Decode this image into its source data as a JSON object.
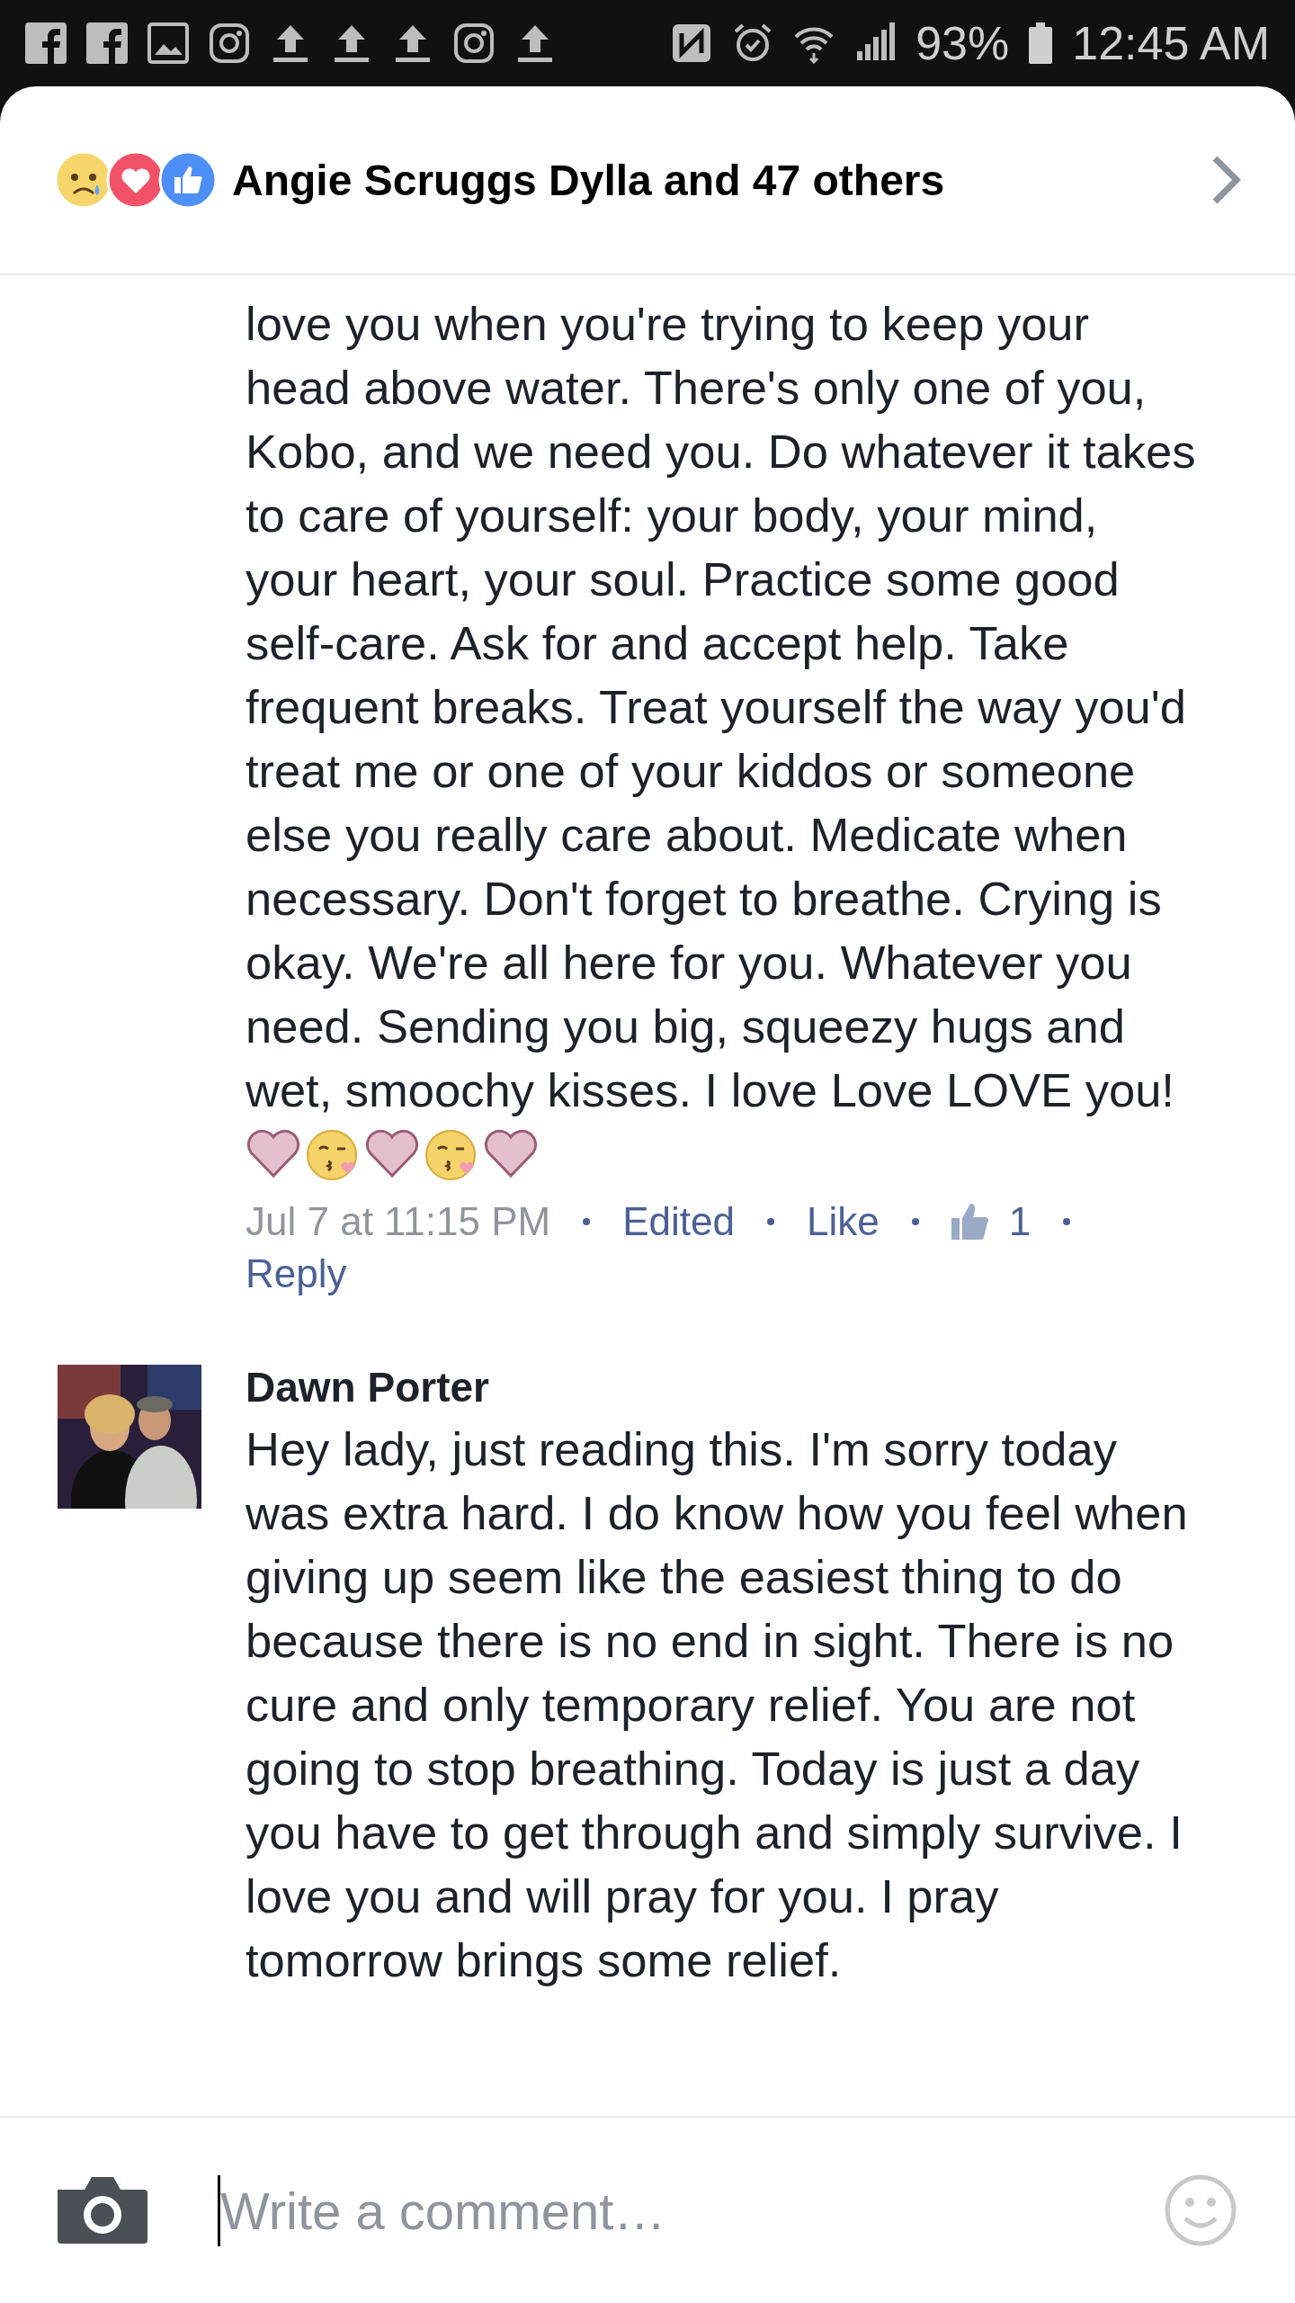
{
  "status_bar": {
    "notifications": [
      {
        "kind": "facebook"
      },
      {
        "kind": "facebook"
      },
      {
        "kind": "gallery"
      },
      {
        "kind": "instagram"
      },
      {
        "kind": "upload"
      },
      {
        "kind": "upload"
      },
      {
        "kind": "upload"
      },
      {
        "kind": "instagram"
      },
      {
        "kind": "upload"
      }
    ],
    "system_icons": [
      {
        "kind": "nfc"
      },
      {
        "kind": "alarm"
      },
      {
        "kind": "wifi"
      },
      {
        "kind": "signal"
      }
    ],
    "battery": "93%",
    "time": "12:45 AM"
  },
  "header": {
    "reactions": [
      {
        "kind": "sad"
      },
      {
        "kind": "love"
      },
      {
        "kind": "like"
      }
    ],
    "title": "Angie Scruggs Dylla and 47 others"
  },
  "comments": [
    {
      "kind": "continued",
      "text": "love you when you're trying to keep your head above water. There's only one of you, Kobo, and we need you. Do whatever it takes to care of yourself: your body, your mind, your heart, your soul. Practice some good self-care. Ask for and accept help. Take frequent breaks. Treat yourself the way you'd treat me or one of your kiddos or someone else you really care about. Medicate when necessary. Don't forget to breathe. Crying is okay. We're all here for you. Whatever you need. Sending you big, squeezy hugs and wet, smoochy kisses. I love Love LOVE you!",
      "emojis": [
        {
          "kind": "heart"
        },
        {
          "kind": "kiss"
        },
        {
          "kind": "heart"
        },
        {
          "kind": "kiss"
        },
        {
          "kind": "heart"
        }
      ],
      "meta": {
        "time": "Jul 7 at 11:15 PM",
        "edited": "Edited",
        "like": "Like",
        "like_count": "1",
        "reply": "Reply"
      }
    },
    {
      "kind": "full",
      "author": "Dawn Porter",
      "text": "Hey lady, just reading this. I'm sorry today was extra hard. I do know how you feel when giving up seem like the easiest thing to do because there is no end in sight. There is no cure and only temporary relief. You are not going to stop breathing. Today is just a day you have to get through and simply survive. I love you and will pray for you. I pray tomorrow brings some relief."
    }
  ],
  "composer": {
    "placeholder": "Write a comment…"
  }
}
